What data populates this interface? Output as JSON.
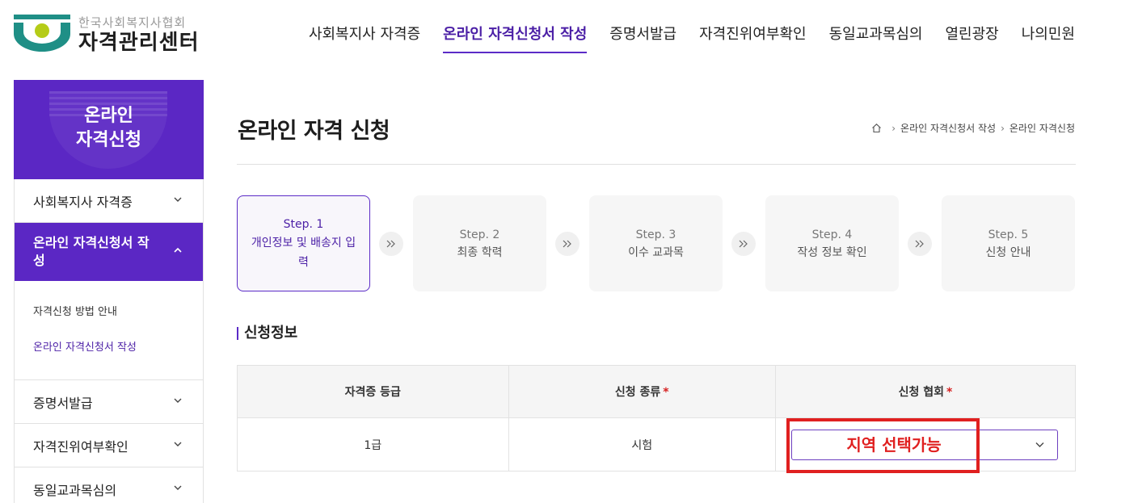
{
  "header": {
    "logo_sub": "한국사회복지사협회",
    "logo_main": "자격관리센터",
    "nav": [
      {
        "label": "사회복지사 자격증"
      },
      {
        "label": "온라인 자격신청서 작성"
      },
      {
        "label": "증명서발급"
      },
      {
        "label": "자격진위여부확인"
      },
      {
        "label": "동일교과목심의"
      },
      {
        "label": "열린광장"
      },
      {
        "label": "나의민원"
      }
    ]
  },
  "sidebar": {
    "title": "온라인\n자격신청",
    "title_line1": "온라인",
    "title_line2": "자격신청",
    "items": [
      {
        "label": "사회복지사 자격증"
      },
      {
        "label": "온라인 자격신청서 작성"
      },
      {
        "label": "증명서발급"
      },
      {
        "label": "자격진위여부확인"
      },
      {
        "label": "동일교과목심의"
      }
    ],
    "sub_items": [
      {
        "label": "자격신청 방법 안내"
      },
      {
        "label": "온라인 자격신청서 작성"
      }
    ]
  },
  "main": {
    "title": "온라인 자격 신청",
    "breadcrumb": [
      "온라인 자격신청서 작성",
      "온라인 자격신청"
    ],
    "steps": [
      {
        "num": "Step. 1",
        "label": "개인정보 및 배송지 입력"
      },
      {
        "num": "Step. 2",
        "label": "최종 학력"
      },
      {
        "num": "Step. 3",
        "label": "이수 교과목"
      },
      {
        "num": "Step. 4",
        "label": "작성 정보 확인"
      },
      {
        "num": "Step. 5",
        "label": "신청 안내"
      }
    ],
    "section_title": "신청정보",
    "table": {
      "headers": [
        "자격증 등급",
        "신청 종류",
        "신청 협회"
      ],
      "required_mark": "*",
      "row": {
        "grade": "1급",
        "type": "시험"
      },
      "select_value": ""
    },
    "annotation": "지역 선택가능"
  },
  "colors": {
    "accent": "#5b27c4",
    "annotation": "#e02020"
  }
}
